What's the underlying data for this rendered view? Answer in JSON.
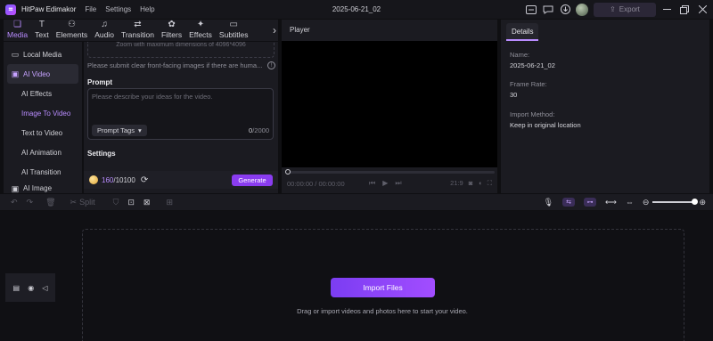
{
  "titlebar": {
    "app_name": "HitPaw Edimakor",
    "menus": [
      "File",
      "Settings",
      "Help"
    ],
    "project_title": "2025-06-21_02",
    "export_label": "Export"
  },
  "tabs": [
    {
      "label": "Media",
      "icon": "media-icon"
    },
    {
      "label": "Text",
      "icon": "text-icon"
    },
    {
      "label": "Elements",
      "icon": "elements-icon"
    },
    {
      "label": "Audio",
      "icon": "audio-icon"
    },
    {
      "label": "Transition",
      "icon": "transition-icon"
    },
    {
      "label": "Filters",
      "icon": "filters-icon"
    },
    {
      "label": "Effects",
      "icon": "effects-icon"
    },
    {
      "label": "Subtitles",
      "icon": "subtitles-icon"
    }
  ],
  "sidebar": {
    "items": [
      {
        "label": "Local Media"
      },
      {
        "label": "AI Video"
      },
      {
        "label": "AI Effects"
      },
      {
        "label": "Image To Video"
      },
      {
        "label": "Text to Video"
      },
      {
        "label": "AI Animation"
      },
      {
        "label": "AI Transition"
      },
      {
        "label": "AI Image"
      }
    ]
  },
  "panel": {
    "upload_tail": "Zoom with maximum dimensions of 4096*4096",
    "hint": "Please submit clear front-facing images if there are huma...",
    "prompt_label": "Prompt",
    "prompt_placeholder": "Please describe your ideas for the video.",
    "prompt_tags": "Prompt Tags",
    "char_count": "0",
    "char_max": "/2000",
    "settings_label": "Settings",
    "credits_used": "160",
    "credits_total": "/10100",
    "generate_label": "Generate"
  },
  "player": {
    "title": "Player",
    "time": "00:00:00 / 00:00:00",
    "aspect": "21:9"
  },
  "details": {
    "tab": "Details",
    "name_label": "Name:",
    "name_value": "2025-06-21_02",
    "frame_rate_label": "Frame Rate:",
    "frame_rate_value": "30",
    "import_method_label": "Import Method:",
    "import_method_value": "Keep in original location"
  },
  "timeline": {
    "split_label": "Split",
    "import_label": "Import Files",
    "drag_hint": "Drag or import videos and photos here to start your video."
  },
  "colors": {
    "accent": "#b98cff",
    "button": "#8a3cf0"
  }
}
